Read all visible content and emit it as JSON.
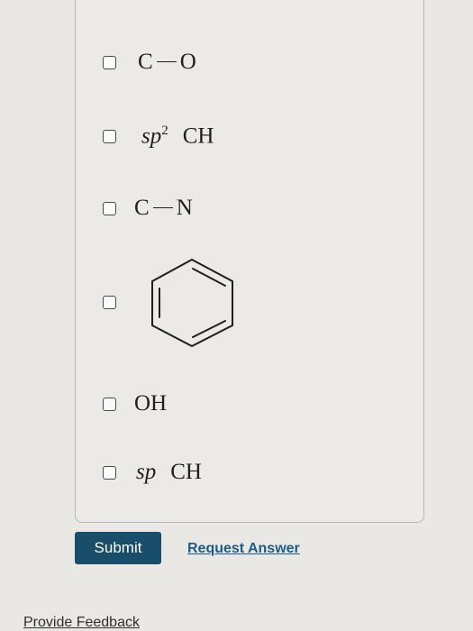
{
  "options": [
    {
      "id": "c-o",
      "atom1": "C",
      "atom2": "O"
    },
    {
      "id": "sp2-ch",
      "hybrid": "sp",
      "superscript": "2",
      "group": "CH"
    },
    {
      "id": "c-n",
      "atom1": "C",
      "atom2": "N"
    },
    {
      "id": "benzene-ring",
      "structure": "benzene-ring"
    },
    {
      "id": "oh",
      "group": "OH"
    },
    {
      "id": "sp-ch",
      "hybrid": "sp",
      "group": "CH"
    }
  ],
  "actions": {
    "submit_label": "Submit",
    "request_answer_label": "Request Answer"
  },
  "footer": {
    "provide_feedback_label": "Provide Feedback"
  }
}
